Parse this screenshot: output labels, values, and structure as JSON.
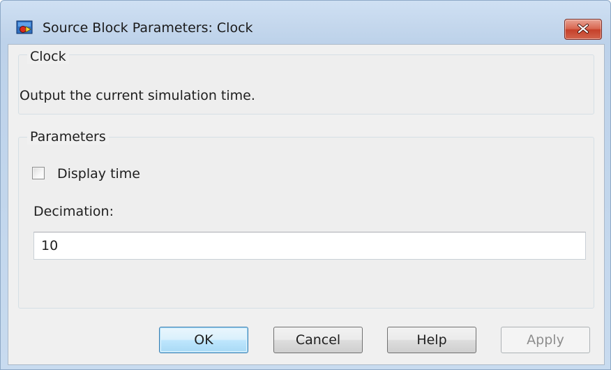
{
  "window": {
    "title": "Source Block Parameters: Clock",
    "app_icon": "simulink-block-icon",
    "close_icon": "close-icon"
  },
  "description_group": {
    "legend": "Clock",
    "text": "Output the current simulation time."
  },
  "parameters_group": {
    "legend": "Parameters",
    "display_time": {
      "label": "Display time",
      "checked": false
    },
    "decimation": {
      "label": "Decimation:",
      "value": "10"
    }
  },
  "buttons": {
    "ok": "OK",
    "cancel": "Cancel",
    "help": "Help",
    "apply": "Apply"
  },
  "colors": {
    "titlebar": "#c3d6ec",
    "close_button": "#c5402a",
    "client_bg": "#f0f0f0",
    "default_button": "#bee6fd"
  }
}
